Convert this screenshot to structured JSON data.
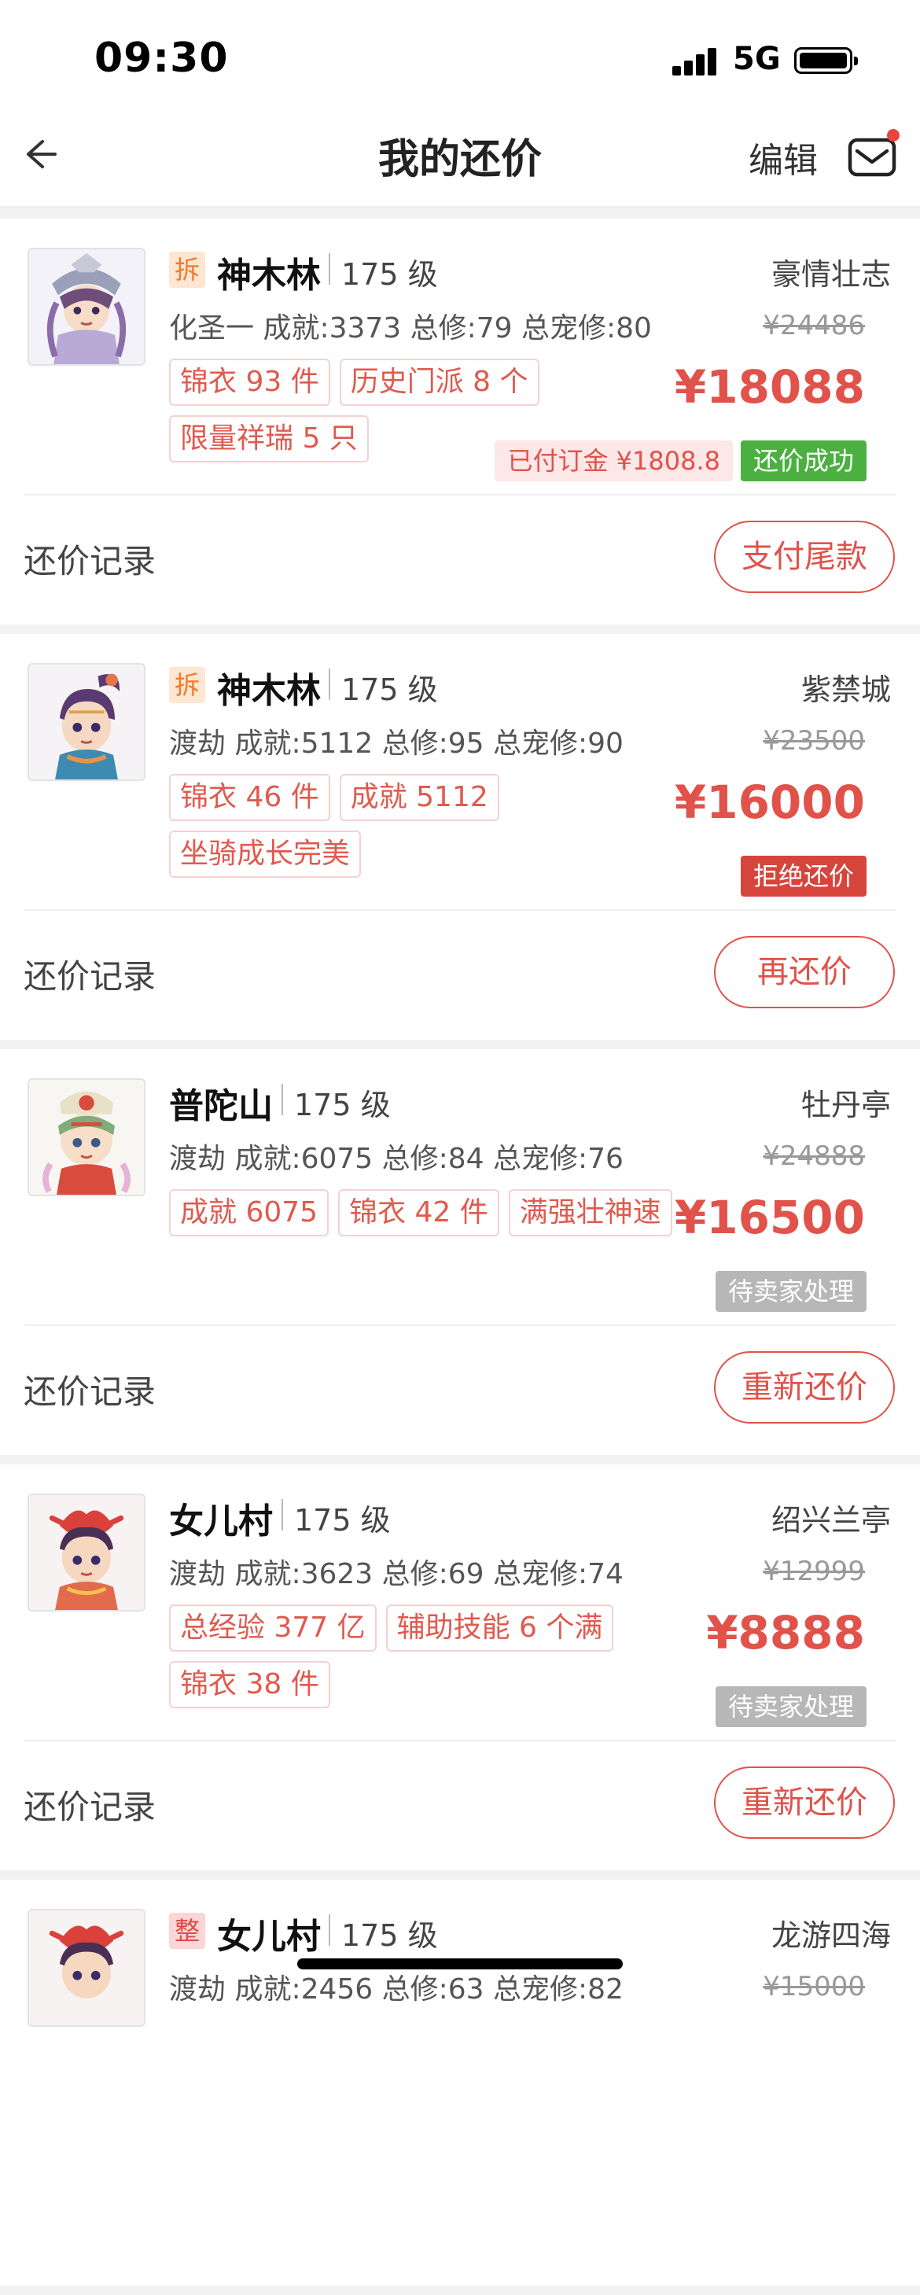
{
  "status_bar": {
    "time": "09:30",
    "network": "5G"
  },
  "nav": {
    "title": "我的还价",
    "edit_label": "编辑"
  },
  "record_label": "还价记录",
  "cards": [
    {
      "tag": "拆",
      "tag_type": "chai",
      "server": "神木林",
      "level": "175 级",
      "region": "豪情壮志",
      "stats": "化圣一  成就:3373  总修:79  总宠修:80",
      "tags": [
        "锦衣 93 件",
        "历史门派 8 个",
        "限量祥瑞 5 只"
      ],
      "original_price": "¥24486",
      "price": "¥18088",
      "deposit": "已付订金 ¥1808.8",
      "status": "还价成功",
      "status_type": "success",
      "action": "支付尾款"
    },
    {
      "tag": "拆",
      "tag_type": "chai",
      "server": "神木林",
      "level": "175 级",
      "region": "紫禁城",
      "stats": "渡劫  成就:5112  总修:95  总宠修:90",
      "tags": [
        "锦衣 46 件",
        "成就 5112",
        "坐骑成长完美"
      ],
      "original_price": "¥23500",
      "price": "¥16000",
      "deposit": "",
      "status": "拒绝还价",
      "status_type": "reject",
      "action": "再还价"
    },
    {
      "tag": "",
      "tag_type": "",
      "server": "普陀山",
      "level": "175 级",
      "region": "牡丹亭",
      "stats": "渡劫  成就:6075  总修:84  总宠修:76",
      "tags": [
        "成就 6075",
        "锦衣 42 件",
        "满强壮神速"
      ],
      "original_price": "¥24888",
      "price": "¥16500",
      "deposit": "",
      "status": "待卖家处理",
      "status_type": "pending",
      "action": "重新还价"
    },
    {
      "tag": "",
      "tag_type": "",
      "server": "女儿村",
      "level": "175 级",
      "region": "绍兴兰亭",
      "stats": "渡劫  成就:3623  总修:69  总宠修:74",
      "tags": [
        "总经验 377 亿",
        "辅助技能 6 个满",
        "锦衣 38 件"
      ],
      "original_price": "¥12999",
      "price": "¥8888",
      "deposit": "",
      "status": "待卖家处理",
      "status_type": "pending",
      "action": "重新还价"
    },
    {
      "tag": "整",
      "tag_type": "zheng",
      "server": "女儿村",
      "level": "175 级",
      "region": "龙游四海",
      "stats": "渡劫  成就:2456  总修:63  总宠修:82",
      "tags": [],
      "original_price": "¥15000",
      "price": "",
      "deposit": "",
      "status": "",
      "status_type": "",
      "action": ""
    }
  ],
  "colors": {
    "accent": "#e0524a",
    "success": "#4cb041",
    "reject": "#d6453c",
    "pending": "#b7b7b7"
  }
}
